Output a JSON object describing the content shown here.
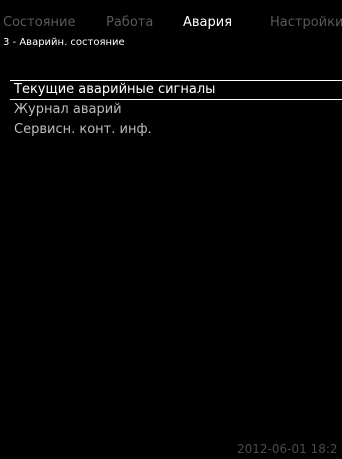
{
  "tabs": [
    {
      "label": "Состояние",
      "active": false
    },
    {
      "label": "Работа",
      "active": false
    },
    {
      "label": "Авария",
      "active": true
    },
    {
      "label": "Настройки",
      "active": false
    }
  ],
  "subtitle": "3 - Аварийн. состояние",
  "menu": {
    "items": [
      {
        "label": "Текущие аварийные сигналы",
        "selected": true
      },
      {
        "label": "Журнал аварий",
        "selected": false
      },
      {
        "label": "Сервисн. конт. инф.",
        "selected": false
      }
    ]
  },
  "footer": {
    "datetime": "2012-06-01 18:2"
  },
  "colors": {
    "background": "#000000",
    "active_text": "#ffffff",
    "inactive_tab": "#5a5a5a",
    "menu_text": "#bdbdbd"
  }
}
